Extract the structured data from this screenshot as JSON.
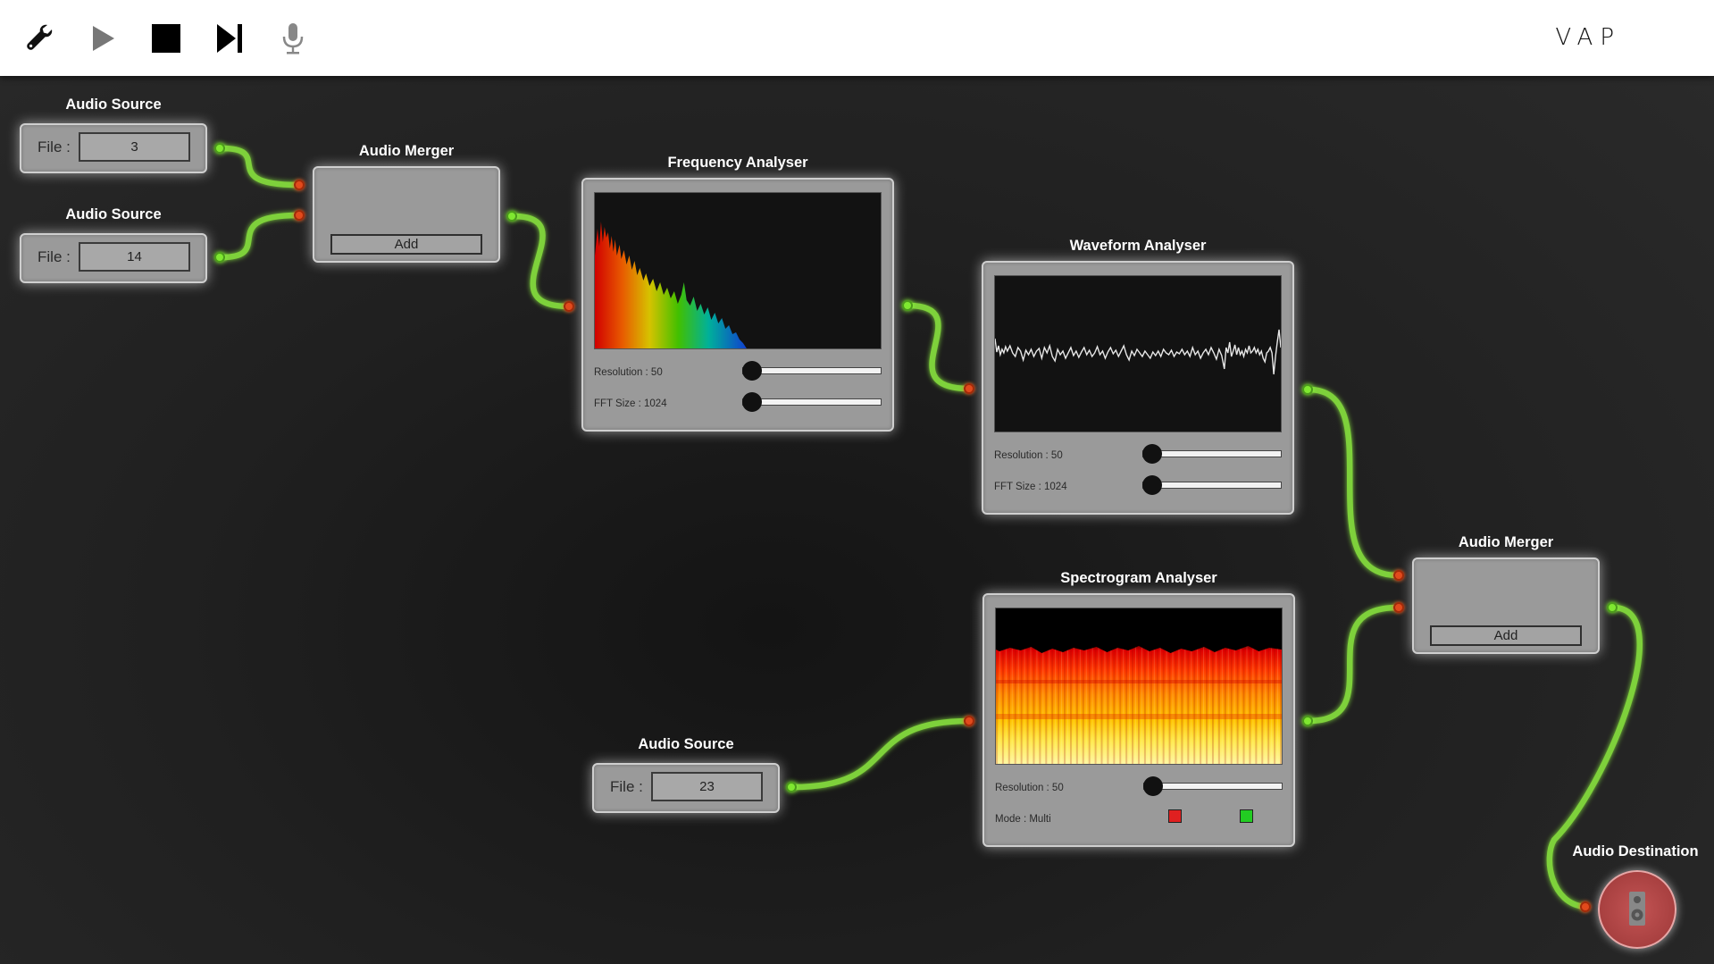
{
  "app": {
    "brand": "VAP"
  },
  "toolbar": {
    "buttons": [
      {
        "id": "settings",
        "icon": "wrench-icon"
      },
      {
        "id": "play",
        "icon": "play-icon"
      },
      {
        "id": "stop",
        "icon": "stop-icon"
      },
      {
        "id": "next",
        "icon": "skip-next-icon"
      },
      {
        "id": "mic",
        "icon": "microphone-icon"
      }
    ]
  },
  "colors": {
    "wire": "#7ed13a",
    "port_out": "#7fe830",
    "port_in": "#e24a1c",
    "node_bg": "#9a9a9a",
    "destination": "#b34848",
    "mode_red": "#e02020",
    "mode_green": "#22cc22"
  },
  "nodes": {
    "source1": {
      "title": "Audio Source",
      "file_label": "File :",
      "file_value": "3"
    },
    "source2": {
      "title": "Audio Source",
      "file_label": "File :",
      "file_value": "14"
    },
    "merger1": {
      "title": "Audio Merger",
      "add_label": "Add"
    },
    "freq": {
      "title": "Frequency Analyser",
      "resolution_label": "Resolution : 50",
      "resolution_value": 0,
      "fft_label": "FFT Size : 1024",
      "fft_value": 0
    },
    "wave": {
      "title": "Waveform Analyser",
      "resolution_label": "Resolution : 50",
      "resolution_value": 0,
      "fft_label": "FFT Size : 1024",
      "fft_value": 0
    },
    "spectro": {
      "title": "Spectrogram Analyser",
      "resolution_label": "Resolution : 50",
      "resolution_value": 0,
      "mode_label": "Mode : Multi"
    },
    "source3": {
      "title": "Audio Source",
      "file_label": "File :",
      "file_value": "23"
    },
    "merger2": {
      "title": "Audio Merger",
      "add_label": "Add"
    },
    "destination": {
      "title": "Audio Destination",
      "icon": "speaker-icon"
    }
  }
}
